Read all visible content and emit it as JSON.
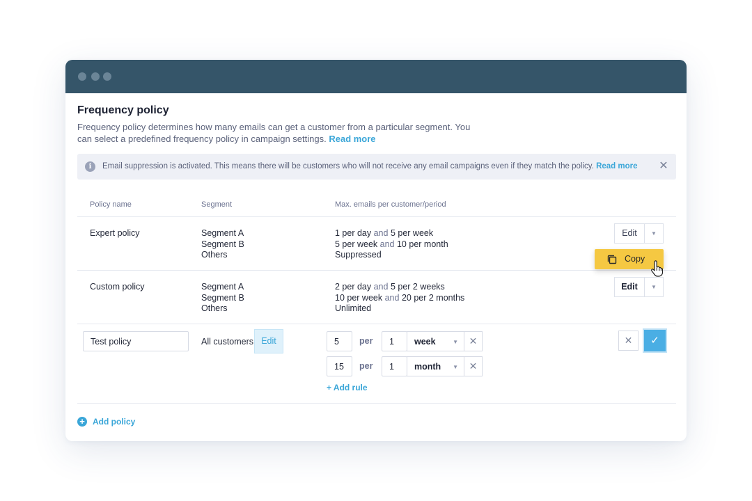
{
  "page": {
    "title": "Frequency policy",
    "description": "Frequency policy determines how many emails can get a customer from a particular segment. You can select a predefined frequency policy in campaign settings.",
    "read_more": "Read more"
  },
  "banner": {
    "text": "Email suppression is activated. This means there will be customers  who will not receive any email campaigns even if they match the policy.",
    "read_more": "Read more",
    "icon": "info-icon"
  },
  "table": {
    "headers": [
      "Policy name",
      "Segment",
      "Max. emails per customer/period"
    ],
    "rows": [
      {
        "name": "Expert policy",
        "segments": [
          "Segment A",
          "Segment B",
          "Others"
        ],
        "rules": [
          {
            "a": "1 per day",
            "conj": "and",
            "b": "5 per week"
          },
          {
            "a": "5 per week",
            "conj": "and",
            "b": "10 per month"
          },
          {
            "a": "Suppressed",
            "conj": "",
            "b": ""
          }
        ],
        "edit_label": "Edit"
      },
      {
        "name": "Custom policy",
        "segments": [
          "Segment A",
          "Segment B",
          "Others"
        ],
        "rules": [
          {
            "a": "2 per day",
            "conj": "and",
            "b": "5 per 2 weeks"
          },
          {
            "a": "10 per week",
            "conj": "and",
            "b": "20 per 2 months"
          },
          {
            "a": "Unlimited",
            "conj": "",
            "b": ""
          }
        ],
        "edit_label": "Edit"
      }
    ]
  },
  "dropdown": {
    "copy_label": "Copy"
  },
  "edit_row": {
    "name_value": "Test policy",
    "segment_text": "All customers",
    "segment_edit": "Edit",
    "rules": [
      {
        "count": "5",
        "per": "per",
        "interval": "1",
        "period": "week"
      },
      {
        "count": "15",
        "per": "per",
        "interval": "1",
        "period": "month"
      }
    ],
    "add_rule": "+ Add rule"
  },
  "footer": {
    "add_policy": "Add policy"
  },
  "colors": {
    "titlebar": "#355569",
    "accent": "#3aa6d8",
    "copy": "#f5c842",
    "confirm": "#4aaee4"
  }
}
